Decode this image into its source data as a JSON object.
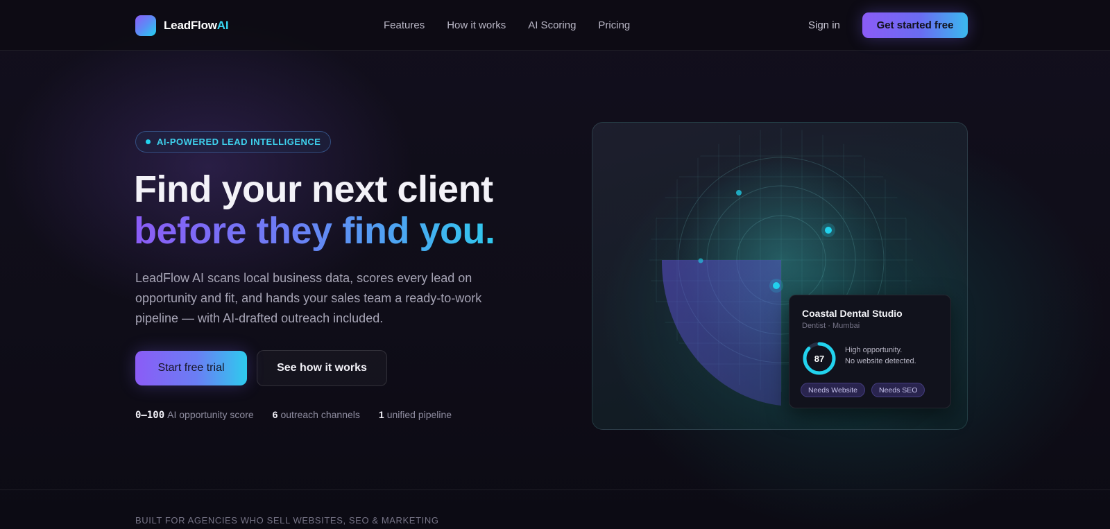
{
  "nav": {
    "brand_main": "LeadFlow",
    "brand_accent": "AI",
    "links": [
      "Features",
      "How it works",
      "AI Scoring",
      "Pricing"
    ],
    "signin": "Sign in",
    "cta": "Get started free"
  },
  "hero": {
    "badge": "AI-POWERED LEAD INTELLIGENCE",
    "headline_line1": "Find your next client",
    "headline_line2": "before they find you.",
    "description": "LeadFlow AI scans local business data, scores every lead on opportunity and fit, and hands your sales team a ready-to-work pipeline — with AI-drafted outreach included.",
    "primary_button": "Start free trial",
    "secondary_button": "See how it works",
    "stats": [
      {
        "value": "0–100",
        "label": "AI opportunity score"
      },
      {
        "value": "6",
        "label": "outreach channels"
      },
      {
        "value": "1",
        "label": "unified pipeline"
      }
    ]
  },
  "lead_card": {
    "name": "Coastal Dental Studio",
    "meta": "Dentist · Mumbai",
    "score": "87",
    "score_fraction": 0.87,
    "description_line1": "High opportunity.",
    "description_line2": "No website detected.",
    "tags": [
      "Needs Website",
      "Needs SEO"
    ]
  },
  "footer_strip": {
    "text": "BUILT FOR AGENCIES WHO SELL WEBSITES, SEO & MARKETING"
  },
  "colors": {
    "accent_purple": "#8b5cf6",
    "accent_cyan": "#22d3ee",
    "background": "#0d0b16"
  },
  "icons": [
    "logo-mark",
    "badge-dot",
    "radar-dot"
  ]
}
